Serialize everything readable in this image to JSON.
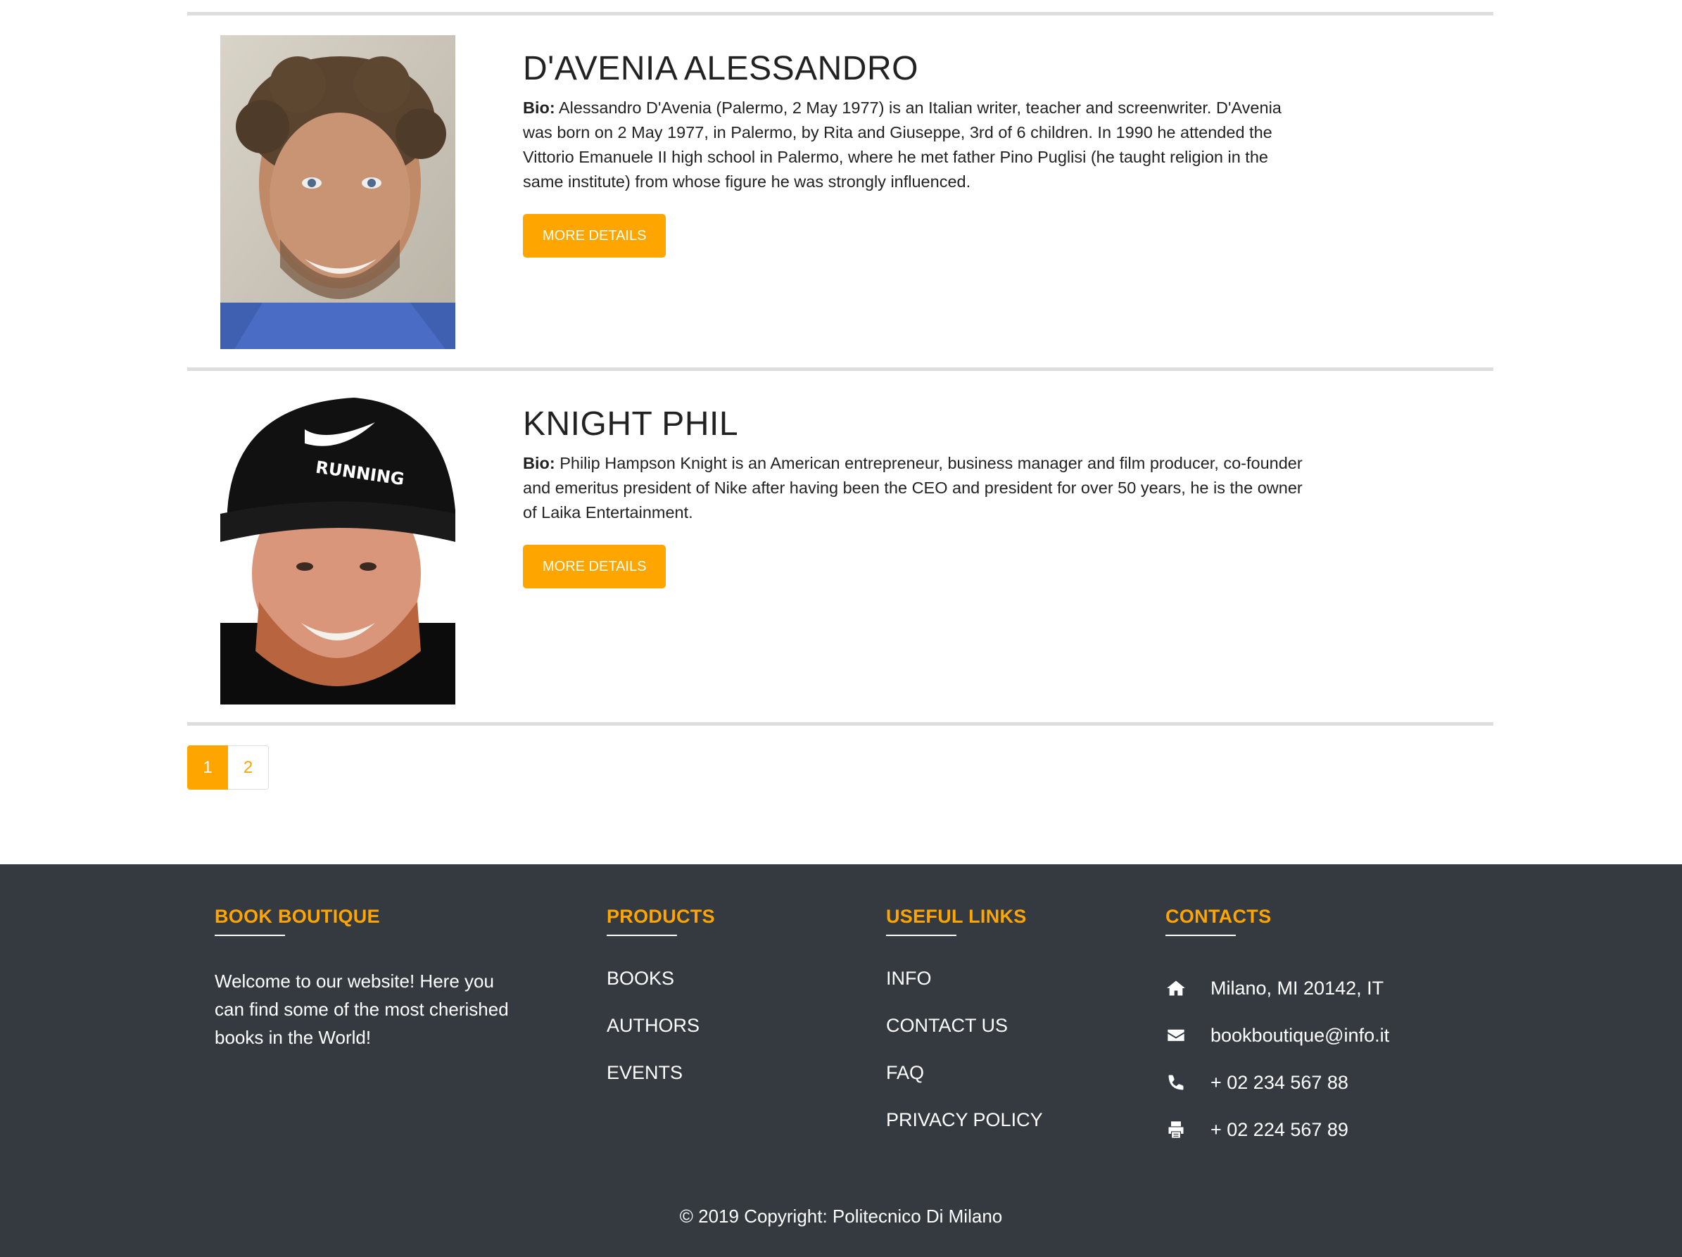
{
  "authors": [
    {
      "name": "D'AVENIA ALESSANDRO",
      "bio_label": "Bio:",
      "bio": "Alessandro D'Avenia (Palermo, 2 May 1977) is an Italian writer, teacher and screenwriter. D'Avenia was born on 2 May 1977, in Palermo, by Rita and Giuseppe, 3rd of 6 children. In 1990 he attended the Vittorio Emanuele II high school in Palermo, where he met father Pino Puglisi (he taught religion in the same institute) from whose figure he was strongly influenced.",
      "button": "MORE DETAILS"
    },
    {
      "name": "KNIGHT PHIL",
      "bio_label": "Bio:",
      "bio": "Philip Hampson Knight is an American entrepreneur, business manager and film producer, co-founder and emeritus president of Nike after having been the CEO and president for over 50 years, he is the owner of Laika Entertainment.",
      "button": "MORE DETAILS",
      "cap_text": "RUNNING"
    }
  ],
  "pagination": {
    "pages": [
      "1",
      "2"
    ],
    "active": "1"
  },
  "footer": {
    "about": {
      "heading": "BOOK BOUTIQUE",
      "text": "Welcome to our website! Here you can find some of the most cherished books in the World!"
    },
    "products": {
      "heading": "PRODUCTS",
      "links": [
        "BOOKS",
        "AUTHORS",
        "EVENTS"
      ]
    },
    "useful": {
      "heading": "USEFUL LINKS",
      "links": [
        "INFO",
        "CONTACT US",
        "FAQ",
        "PRIVACY POLICY"
      ]
    },
    "contacts": {
      "heading": "CONTACTS",
      "items": [
        {
          "icon": "home-icon",
          "text": "Milano, MI 20142, IT"
        },
        {
          "icon": "envelope-icon",
          "text": "bookboutique@info.it"
        },
        {
          "icon": "phone-icon",
          "text": "+ 02 234 567 88"
        },
        {
          "icon": "print-icon",
          "text": "+ 02 224 567 89"
        }
      ]
    },
    "copyright": "© 2019 Copyright: Politecnico Di Milano"
  },
  "colors": {
    "accent": "#ffa500",
    "footer_bg": "#343a40",
    "divider": "#dedede"
  }
}
